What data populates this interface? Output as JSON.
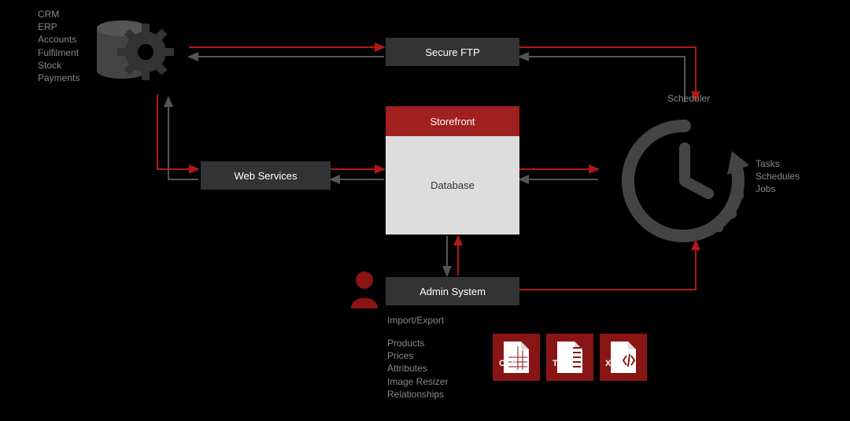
{
  "systems_list": {
    "items": [
      "CRM",
      "ERP",
      "Accounts",
      "Fulfilment",
      "Stock",
      "Payments"
    ]
  },
  "secure_ftp": {
    "label": "Secure FTP"
  },
  "web_services": {
    "label": "Web Services"
  },
  "storefront": {
    "label": "Storefront"
  },
  "database": {
    "label": "Database"
  },
  "admin_system": {
    "label": "Admin System"
  },
  "scheduler": {
    "label": "Scheduler",
    "items": [
      "Tasks",
      "Schedules",
      "Jobs"
    ]
  },
  "import_export": {
    "heading": "Import/Export",
    "items": [
      "Products",
      "Prices",
      "Attributes",
      "Image Resizer",
      "Relationships"
    ]
  },
  "file_formats": {
    "csv": "CSV",
    "tab": "TAB",
    "xml": "XML"
  },
  "colors": {
    "red": "#a01f1f",
    "dark_red": "#8a1515",
    "dark_grey": "#333333",
    "mid_grey": "#444444",
    "light_grey": "#dddddd",
    "arrow_red": "#b01818",
    "arrow_grey": "#444444"
  }
}
